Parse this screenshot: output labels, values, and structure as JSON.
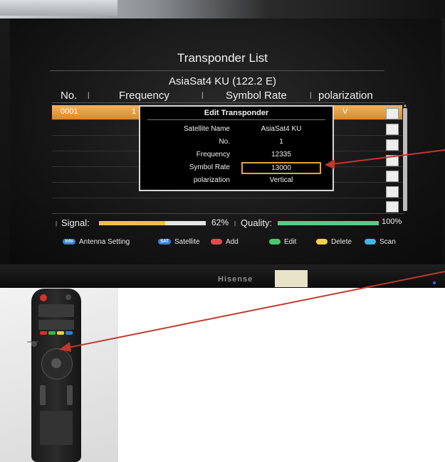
{
  "screen": {
    "title": "Transponder List",
    "satellite": "AsiaSat4 KU (122.2 E)",
    "columns": {
      "no": "No.",
      "frequency": "Frequency",
      "symbol_rate": "Symbol Rate",
      "polarization": "polarization"
    },
    "selected_row": {
      "no": "0001",
      "frequency_partial": "1",
      "polarization_partial": "V"
    }
  },
  "dialog": {
    "title": "Edit Transponder",
    "fields": [
      {
        "label": "Satellite Name",
        "value": "AsiaSat4 KU"
      },
      {
        "label": "No.",
        "value": "1"
      },
      {
        "label": "Frequency",
        "value": "12335"
      },
      {
        "label": "Symbol Rate",
        "value": "13000"
      },
      {
        "label": "polarization",
        "value": "Vertical"
      }
    ]
  },
  "status": {
    "signal_label": "Signal:",
    "signal_value": "62%",
    "signal_level": 0.62,
    "quality_label": "Quality:",
    "quality_value": "100%",
    "quality_level": 1.0
  },
  "legend": [
    {
      "badge": "Info",
      "label": "Antenna Setting",
      "color": "#3b82d6"
    },
    {
      "badge": "SAT",
      "label": "Satellite",
      "color": "#3b82d6"
    },
    {
      "badge": "",
      "label": "Add",
      "color": "#e24b4b"
    },
    {
      "badge": "",
      "label": "Edit",
      "color": "#4cc66a"
    },
    {
      "badge": "",
      "label": "Delete",
      "color": "#f2d24a"
    },
    {
      "badge": "",
      "label": "Scan",
      "color": "#3fb7e6"
    }
  ],
  "tv": {
    "brand": "Hisense"
  },
  "colors": {
    "selected_row": "#e59a3a",
    "highlight_box": "#e0a83a",
    "arrow": "#c0392b"
  }
}
